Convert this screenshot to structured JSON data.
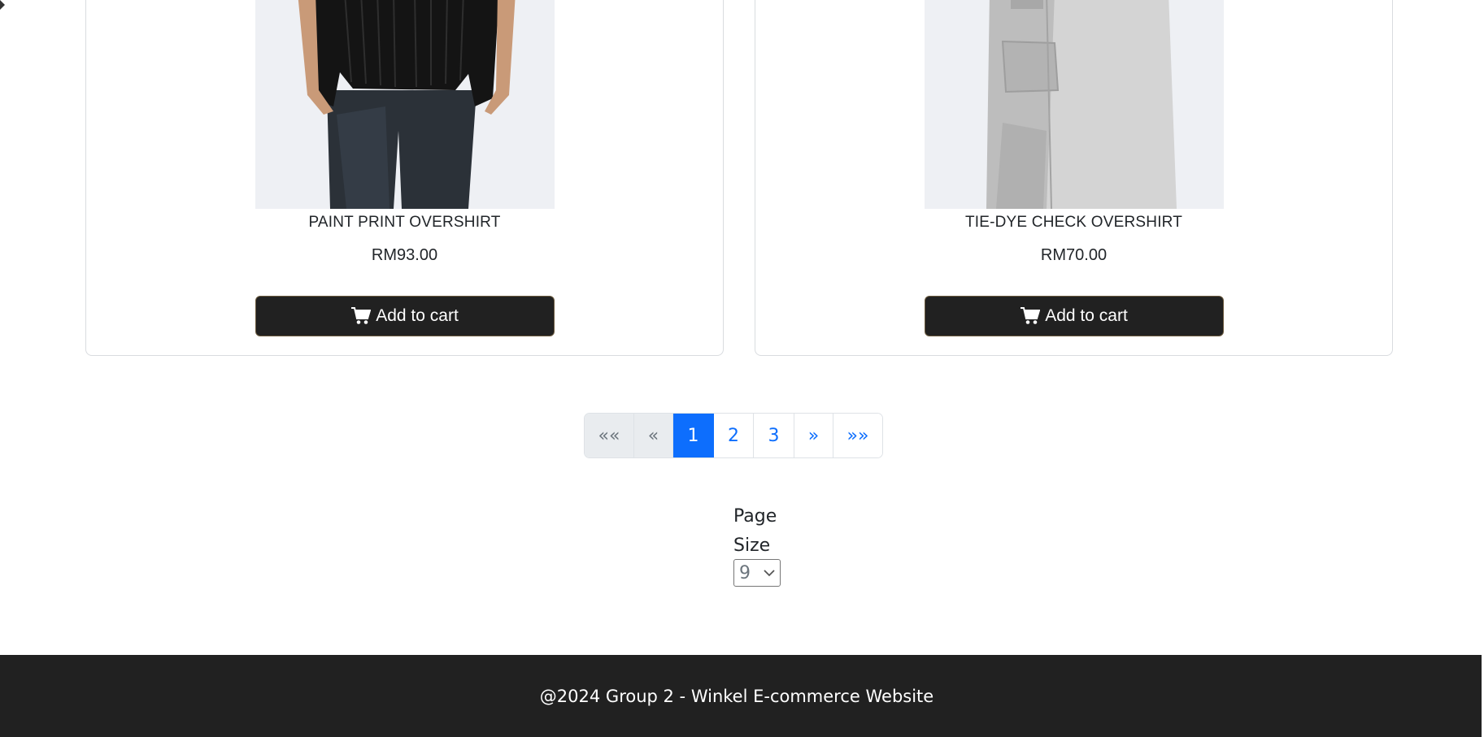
{
  "products": [
    {
      "name": "PAINT PRINT OVERSHIRT",
      "price": "RM93.00",
      "button_label": "Add to cart",
      "image_icon": "black-overshirt-photo"
    },
    {
      "name": "TIE-DYE CHECK OVERSHIRT",
      "price": "RM70.00",
      "button_label": "Add to cart",
      "image_icon": "grey-overshirt-photo"
    }
  ],
  "pagination": {
    "first": "««",
    "prev": "«",
    "pages": [
      "1",
      "2",
      "3"
    ],
    "current": "1",
    "next": "»",
    "last": "»»"
  },
  "page_size": {
    "label": "Page Size",
    "selected": "9"
  },
  "footer": {
    "text": "@2024 Group 2 - Winkel E-commerce Website"
  },
  "colors": {
    "button_bg": "#212121",
    "active_page": "#0d6efd",
    "footer_bg": "#212121"
  }
}
